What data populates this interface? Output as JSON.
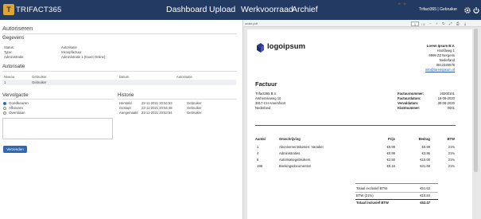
{
  "app": {
    "logo_mark": "T",
    "logo_text": "TRIFACT365"
  },
  "nav": [
    "Dashboard",
    "Upload",
    "Werkvoorraad",
    "Archief"
  ],
  "user": "Trifact365 | Gebruiker",
  "icons": {
    "settings": "gear-icon",
    "power": "power-icon"
  },
  "left": {
    "title": "Autoriseren",
    "gegevens": {
      "heading": "Gegevens",
      "rows": [
        {
          "label": "Status:",
          "value": "Autorisatie"
        },
        {
          "label": "Type:",
          "value": "Inkoopfactuur"
        },
        {
          "label": "Administratie:",
          "value": "Administratie 1 (Exact Online)"
        }
      ]
    },
    "autorisatie": {
      "heading": "Autorisatie",
      "columns": [
        "Niveau",
        "Gebruiker",
        "Datum",
        "Autorisatie"
      ],
      "rows": [
        [
          "1",
          "Gebruiker",
          "",
          ""
        ]
      ]
    },
    "vervolgactie": {
      "heading": "Vervolgactie",
      "options": [
        "Goedkeuren",
        "Afkeuren",
        "Overslaan"
      ],
      "selected": 0
    },
    "historie": {
      "heading": "Historie",
      "rows": [
        [
          "Hersteld",
          "22-11-2021 20:54:53",
          "Gebruiker"
        ],
        [
          "Gestopt",
          "22-11-2021 20:54:48",
          "Gebruiker"
        ],
        [
          "Aangemaakt",
          "22-11-2021 20:53:54",
          "Gebruiker"
        ]
      ]
    },
    "button": "Verzenden"
  },
  "viewer": {
    "filename": "order.pdf",
    "page": "1",
    "pages": "/ 2"
  },
  "invoice": {
    "logo_text": "logoipsum",
    "company": [
      "Lorem Ipsum B.V.",
      "Hoofdweg 1",
      "9999 ZZ  Nergens",
      "Nederland",
      "0612345678",
      "info@loremipsum.nl"
    ],
    "title": "Factuur",
    "customer": [
      "Trifact365 B.V.",
      "Amhemseweg 10",
      "3817-CH  Amersfoort",
      "Nederland"
    ],
    "meta": [
      {
        "label": "Factuurnummer:",
        "value": "20200101"
      },
      {
        "label": "Factuurdatum:",
        "value": "16-06-2020"
      },
      {
        "label": "Vervaldatum:",
        "value": "30-06-2020"
      },
      {
        "label": "Klantnummer:",
        "value": "0001"
      }
    ],
    "columns": [
      "Aantal",
      "Omschrijving",
      "Prijs",
      "Bedrag",
      "BTW"
    ],
    "lines": [
      [
        "1",
        "Abonnementskosten: Variabel",
        "€0.99",
        "€0.99",
        "21%"
      ],
      [
        "4",
        "Administraties",
        "€0.99",
        "€3.96",
        "21%"
      ],
      [
        "6",
        "Autorisatiegebruikers",
        "€2.50",
        "€15.00",
        "21%"
      ],
      [
        "198",
        "Boekingsdocumenten",
        "€0.16",
        "€31.68",
        "21%"
      ]
    ],
    "totals": [
      {
        "label": "Totaal exclusief BTW",
        "value": "€51.63"
      },
      {
        "label": "BTW (21%)",
        "value": "€10.84"
      },
      {
        "label": "Totaal inclusief BTW",
        "value": "€62.47"
      }
    ]
  }
}
